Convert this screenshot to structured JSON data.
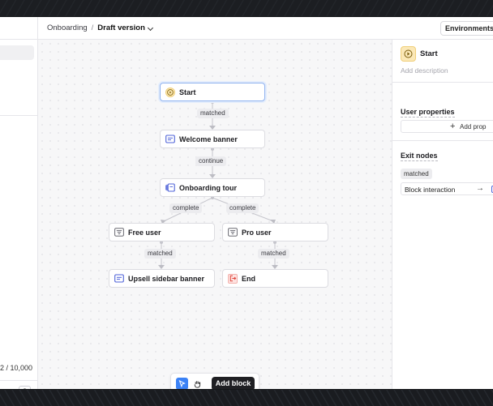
{
  "breadcrumb": {
    "parent": "Onboarding",
    "separator": "/",
    "current": "Draft version"
  },
  "header": {
    "environments_label": "Environments"
  },
  "left_panel": {
    "count_text": "2 / 10,000",
    "help_label": "?"
  },
  "flow": {
    "nodes": [
      {
        "id": "start",
        "label": "Start",
        "icon": "play-icon",
        "selected": true
      },
      {
        "id": "welcome",
        "label": "Welcome banner",
        "icon": "banner-icon"
      },
      {
        "id": "tour",
        "label": "Onboarding tour",
        "icon": "tour-icon"
      },
      {
        "id": "free",
        "label": "Free user",
        "icon": "filter-icon"
      },
      {
        "id": "pro",
        "label": "Pro user",
        "icon": "filter-icon"
      },
      {
        "id": "upsell",
        "label": "Upsell sidebar banner",
        "icon": "banner-icon"
      },
      {
        "id": "end",
        "label": "End",
        "icon": "exit-icon"
      }
    ],
    "edge_labels": {
      "start_welcome": "matched",
      "welcome_tour": "continue",
      "tour_free": "complete",
      "tour_pro": "complete",
      "free_upsell": "matched",
      "pro_end": "matched"
    }
  },
  "toolbar": {
    "pointer_tool": "pointer-icon",
    "hand_tool": "hand-icon",
    "add_block_label": "Add block"
  },
  "inspector": {
    "node_title": "Start",
    "description_placeholder": "Add description",
    "user_properties_heading": "User properties",
    "add_property_label": "Add prop",
    "exit_nodes_heading": "Exit nodes",
    "exit_condition": "matched",
    "exit_action": "Block interaction"
  },
  "colors": {
    "accent_blue": "#3b82f6",
    "start_icon_bg": "#fbe8b7",
    "banner_icon": "#4f63d8",
    "end_icon": "#e0483e"
  }
}
